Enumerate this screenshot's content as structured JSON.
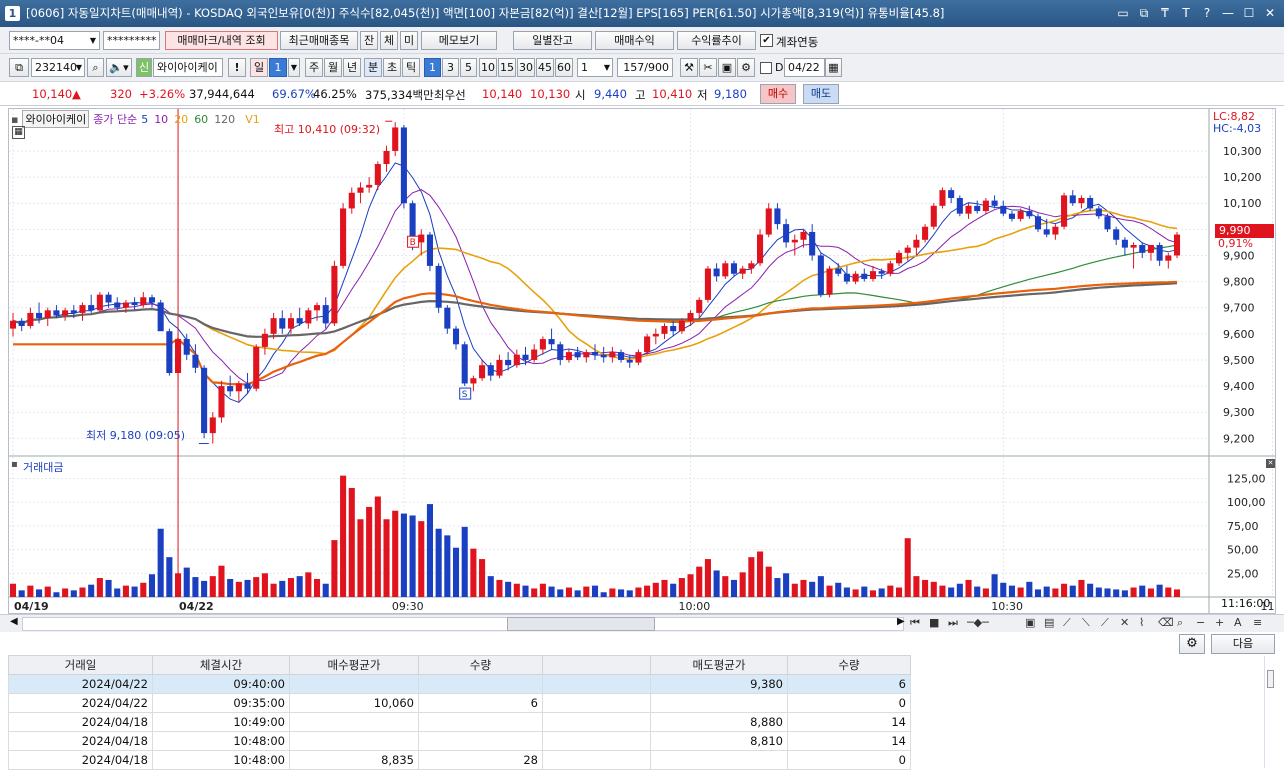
{
  "window": {
    "num": "1",
    "title": "[0606] 자동일지차트(매매내역) - KOSDAQ 외국인보유[0(천)] 주식수[82,045(천)] 액면[100] 자본금[82(억)] 결산[12월] EPS[165] PER[61.50] 시가총액[8,319(억)] 유통비율[45.8]",
    "icons": [
      "layout-icon",
      "restore-icon",
      "pin-icon",
      "font-icon",
      "help-icon",
      "minimize-icon",
      "maximize-icon",
      "close-icon"
    ],
    "icon_glyphs": [
      "▭",
      "⧉",
      "₸",
      "T",
      "?",
      "—",
      "☐",
      "✕"
    ]
  },
  "toolbar1": {
    "account": "****-**04",
    "password": "*********",
    "btn_mark": "매매마크/내역 조회",
    "btn_recent": "최근매매종목",
    "btn_jan": "잔",
    "btn_che": "체",
    "btn_mi": "미",
    "btn_memo": "메모보기",
    "btn_daily": "일별잔고",
    "btn_profit": "매매수익",
    "btn_rate": "수익률추이",
    "chk_link": "계좌연동"
  },
  "toolbar2": {
    "code": "232140",
    "credit_badge": "신",
    "name": "와이아이케이",
    "excl": "!",
    "p_day": "일",
    "p_day_n": "1",
    "p_week": "주",
    "p_month": "월",
    "p_year": "년",
    "p_min": "분",
    "p_sec": "초",
    "p_tick": "틱",
    "mins": [
      "1",
      "3",
      "5",
      "10",
      "15",
      "30",
      "45",
      "60"
    ],
    "count": "1",
    "range": "157",
    "range_total": "/900",
    "chk_d": "D",
    "date": "04/22"
  },
  "quote": {
    "price": "10,140",
    "arrow": "▲",
    "change": "320",
    "pct": "+3.26%",
    "volume": "37,944,644",
    "r1": "69.67%",
    "r2": "46.25%",
    "amount": "375,334백만",
    "bid_label": "최우선",
    "bid1": "10,140",
    "bid2": "10,130",
    "open_l": "시",
    "open": "9,440",
    "high_l": "고",
    "high": "10,410",
    "low_l": "저",
    "low": "9,180",
    "buy": "매수",
    "sell": "매도"
  },
  "chart": {
    "legend_name": "와이아이케이",
    "legend_ma": "종가 단순",
    "ma_periods": [
      "5",
      "10",
      "20",
      "60",
      "120"
    ],
    "ma_colors": [
      "#1a3fc0",
      "#8a1fb0",
      "#e8a10d",
      "#2e8b3a",
      "#666666"
    ],
    "legend_v1": "V1",
    "max_label": "최고 10,410 (09:32)",
    "min_label": "최저 9,180 (09:05)",
    "lc": "LC:8,82",
    "hc": "HC:-4,03",
    "cur_price": "9,990",
    "cur_pct": "0,91%",
    "buy_mark": "B",
    "sell_mark": "S",
    "vol_title": "거래대금",
    "dates": [
      "04/19",
      "04/22",
      "09:30",
      "10:00",
      "10:30",
      "11:00"
    ],
    "time_now": "11:16:00"
  },
  "chart_data": {
    "type": "candlestick",
    "price_axis": {
      "ticks": [
        "10,300",
        "10,200",
        "10,100",
        "10,000",
        "9,900",
        "9,800",
        "9,700",
        "9,600",
        "9,500",
        "9,400",
        "9,300",
        "9,200"
      ],
      "range": [
        9140,
        10430
      ]
    },
    "volume_axis": {
      "ticks": [
        "125,00",
        "100,00",
        "75,00",
        "50,00",
        "25,00"
      ],
      "range": [
        0,
        135
      ]
    },
    "candles": [
      [
        9620,
        9680,
        9590,
        9650
      ],
      [
        9650,
        9660,
        9610,
        9630
      ],
      [
        9630,
        9700,
        9620,
        9680
      ],
      [
        9680,
        9720,
        9640,
        9660
      ],
      [
        9660,
        9700,
        9630,
        9690
      ],
      [
        9690,
        9710,
        9660,
        9670
      ],
      [
        9670,
        9700,
        9650,
        9690
      ],
      [
        9690,
        9710,
        9660,
        9680
      ],
      [
        9680,
        9720,
        9650,
        9710
      ],
      [
        9710,
        9750,
        9680,
        9690
      ],
      [
        9690,
        9760,
        9680,
        9750
      ],
      [
        9750,
        9760,
        9700,
        9720
      ],
      [
        9720,
        9740,
        9690,
        9700
      ],
      [
        9700,
        9730,
        9680,
        9720
      ],
      [
        9720,
        9740,
        9690,
        9710
      ],
      [
        9710,
        9760,
        9700,
        9740
      ],
      [
        9740,
        9750,
        9700,
        9720
      ],
      [
        9720,
        9730,
        9660,
        9610
      ],
      [
        9610,
        9620,
        9440,
        9450
      ],
      [
        9450,
        9600,
        9420,
        9580
      ],
      [
        9580,
        9600,
        9500,
        9520
      ],
      [
        9520,
        9560,
        9450,
        9470
      ],
      [
        9470,
        9480,
        9200,
        9220
      ],
      [
        9220,
        9300,
        9180,
        9280
      ],
      [
        9280,
        9420,
        9260,
        9400
      ],
      [
        9400,
        9440,
        9360,
        9380
      ],
      [
        9380,
        9420,
        9340,
        9410
      ],
      [
        9410,
        9450,
        9370,
        9390
      ],
      [
        9390,
        9560,
        9380,
        9550
      ],
      [
        9550,
        9620,
        9520,
        9600
      ],
      [
        9600,
        9680,
        9580,
        9660
      ],
      [
        9660,
        9690,
        9600,
        9620
      ],
      [
        9620,
        9680,
        9600,
        9660
      ],
      [
        9660,
        9700,
        9630,
        9640
      ],
      [
        9640,
        9700,
        9620,
        9690
      ],
      [
        9690,
        9720,
        9650,
        9710
      ],
      [
        9710,
        9740,
        9620,
        9640
      ],
      [
        9640,
        9880,
        9630,
        9860
      ],
      [
        9860,
        10100,
        9850,
        10080
      ],
      [
        10080,
        10160,
        10060,
        10140
      ],
      [
        10140,
        10180,
        10100,
        10160
      ],
      [
        10160,
        10200,
        10140,
        10170
      ],
      [
        10170,
        10260,
        10150,
        10250
      ],
      [
        10250,
        10320,
        10220,
        10300
      ],
      [
        10300,
        10410,
        10280,
        10390
      ],
      [
        10390,
        10400,
        10080,
        10100
      ],
      [
        10100,
        10110,
        9920,
        9950
      ],
      [
        9950,
        10000,
        9900,
        9980
      ],
      [
        9980,
        9990,
        9840,
        9860
      ],
      [
        9860,
        9870,
        9680,
        9700
      ],
      [
        9700,
        9710,
        9600,
        9620
      ],
      [
        9620,
        9630,
        9540,
        9560
      ],
      [
        9560,
        9570,
        9400,
        9410
      ],
      [
        9410,
        9440,
        9380,
        9430
      ],
      [
        9430,
        9500,
        9420,
        9480
      ],
      [
        9480,
        9490,
        9420,
        9440
      ],
      [
        9440,
        9520,
        9430,
        9500
      ],
      [
        9500,
        9530,
        9460,
        9480
      ],
      [
        9480,
        9540,
        9470,
        9520
      ],
      [
        9520,
        9550,
        9480,
        9500
      ],
      [
        9500,
        9560,
        9490,
        9540
      ],
      [
        9540,
        9590,
        9520,
        9580
      ],
      [
        9580,
        9620,
        9540,
        9560
      ],
      [
        9560,
        9570,
        9480,
        9500
      ],
      [
        9500,
        9540,
        9490,
        9530
      ],
      [
        9530,
        9550,
        9500,
        9510
      ],
      [
        9510,
        9540,
        9490,
        9530
      ],
      [
        9530,
        9560,
        9500,
        9520
      ],
      [
        9520,
        9550,
        9490,
        9510
      ],
      [
        9510,
        9550,
        9490,
        9530
      ],
      [
        9530,
        9540,
        9490,
        9500
      ],
      [
        9500,
        9520,
        9470,
        9490
      ],
      [
        9490,
        9540,
        9480,
        9530
      ],
      [
        9530,
        9600,
        9520,
        9590
      ],
      [
        9590,
        9620,
        9560,
        9600
      ],
      [
        9600,
        9640,
        9580,
        9630
      ],
      [
        9630,
        9650,
        9590,
        9610
      ],
      [
        9610,
        9660,
        9600,
        9650
      ],
      [
        9650,
        9690,
        9630,
        9680
      ],
      [
        9680,
        9740,
        9660,
        9730
      ],
      [
        9730,
        9860,
        9720,
        9850
      ],
      [
        9850,
        9870,
        9800,
        9820
      ],
      [
        9820,
        9880,
        9810,
        9870
      ],
      [
        9870,
        9880,
        9820,
        9830
      ],
      [
        9830,
        9860,
        9810,
        9850
      ],
      [
        9850,
        9880,
        9830,
        9870
      ],
      [
        9870,
        10000,
        9860,
        9980
      ],
      [
        9980,
        10100,
        9970,
        10080
      ],
      [
        10080,
        10100,
        10000,
        10020
      ],
      [
        10020,
        10040,
        9930,
        9950
      ],
      [
        9950,
        9980,
        9900,
        9960
      ],
      [
        9960,
        10000,
        9930,
        9990
      ],
      [
        9990,
        10020,
        9880,
        9900
      ],
      [
        9900,
        9910,
        9740,
        9750
      ],
      [
        9750,
        9860,
        9740,
        9850
      ],
      [
        9850,
        9870,
        9820,
        9830
      ],
      [
        9830,
        9860,
        9790,
        9800
      ],
      [
        9800,
        9840,
        9790,
        9830
      ],
      [
        9830,
        9850,
        9800,
        9810
      ],
      [
        9810,
        9860,
        9800,
        9840
      ],
      [
        9840,
        9850,
        9810,
        9830
      ],
      [
        9830,
        9880,
        9820,
        9870
      ],
      [
        9870,
        9920,
        9860,
        9910
      ],
      [
        9910,
        9940,
        9880,
        9930
      ],
      [
        9930,
        9980,
        9900,
        9960
      ],
      [
        9960,
        10020,
        9950,
        10010
      ],
      [
        10010,
        10100,
        10000,
        10090
      ],
      [
        10090,
        10160,
        10080,
        10150
      ],
      [
        10150,
        10160,
        10100,
        10120
      ],
      [
        10120,
        10130,
        10050,
        10060
      ],
      [
        10060,
        10100,
        10040,
        10090
      ],
      [
        10090,
        10110,
        10060,
        10070
      ],
      [
        10070,
        10120,
        10060,
        10110
      ],
      [
        10110,
        10130,
        10080,
        10090
      ],
      [
        10090,
        10110,
        10050,
        10060
      ],
      [
        10060,
        10070,
        10030,
        10040
      ],
      [
        10040,
        10080,
        10030,
        10070
      ],
      [
        10070,
        10090,
        10040,
        10050
      ],
      [
        10050,
        10060,
        9990,
        10000
      ],
      [
        10000,
        10040,
        9970,
        9980
      ],
      [
        9980,
        10020,
        9960,
        10010
      ],
      [
        10010,
        10140,
        10000,
        10130
      ],
      [
        10130,
        10150,
        10090,
        10100
      ],
      [
        10100,
        10130,
        10080,
        10120
      ],
      [
        10120,
        10130,
        10070,
        10080
      ],
      [
        10080,
        10090,
        10040,
        10050
      ],
      [
        10050,
        10060,
        9990,
        10000
      ],
      [
        10000,
        10010,
        9940,
        9960
      ],
      [
        9960,
        9970,
        9900,
        9930
      ],
      [
        9930,
        9950,
        9850,
        9940
      ],
      [
        9940,
        9950,
        9890,
        9910
      ],
      [
        9910,
        9920,
        9880,
        9940
      ],
      [
        9940,
        9950,
        9860,
        9880
      ],
      [
        9880,
        9910,
        9850,
        9900
      ],
      [
        9900,
        9990,
        9890,
        9980
      ]
    ],
    "volume": [
      14,
      7,
      12,
      8,
      11,
      5,
      9,
      7,
      10,
      13,
      20,
      18,
      9,
      12,
      11,
      15,
      24,
      72,
      42,
      25,
      31,
      21,
      17,
      22,
      33,
      19,
      16,
      18,
      21,
      25,
      14,
      17,
      20,
      22,
      26,
      19,
      14,
      60,
      128,
      115,
      82,
      95,
      106,
      82,
      91,
      88,
      86,
      80,
      98,
      72,
      65,
      52,
      74,
      51,
      40,
      22,
      18,
      16,
      14,
      12,
      9,
      14,
      11,
      8,
      10,
      7,
      11,
      12,
      5,
      9,
      8,
      7,
      10,
      12,
      15,
      18,
      14,
      20,
      24,
      32,
      40,
      28,
      22,
      18,
      26,
      42,
      48,
      32,
      20,
      25,
      14,
      18,
      16,
      22,
      12,
      15,
      10,
      8,
      11,
      7,
      9,
      12,
      10,
      62,
      22,
      18,
      16,
      12,
      10,
      14,
      18,
      11,
      9,
      24,
      15,
      12,
      10,
      16,
      8,
      11,
      9,
      14,
      12,
      18,
      14,
      10,
      9,
      8,
      7,
      10,
      12,
      9,
      13,
      10,
      8,
      6,
      9,
      11,
      8,
      7,
      10
    ]
  },
  "hscroll": {
    "left_arrow": "◀",
    "right_arrow": "▶"
  },
  "nav": {
    "icons": [
      "first-icon",
      "stop-icon",
      "last-icon",
      "zoom-slider-icon",
      "layout-a-icon",
      "layout-b-icon",
      "draw-line-icon",
      "draw-trend-icon",
      "draw-fib-icon",
      "draw-x-icon",
      "draw-text-icon",
      "erase-icon",
      "magnifier-icon",
      "minus-icon",
      "plus-icon",
      "text-a-icon",
      "menu-icon"
    ],
    "glyphs": [
      "⏮",
      "■",
      "⏭",
      "─◆─",
      "▣",
      "▤",
      "⟋",
      "⟍",
      "⟋",
      "✕",
      "⌇",
      "⌫",
      "⌕",
      "−",
      "+",
      "A",
      "≡"
    ]
  },
  "grid": {
    "next_btn": "다음",
    "headers": [
      "거래일",
      "체결시간",
      "매수평균가",
      "수량",
      "",
      "매도평균가",
      "수량"
    ],
    "rows": [
      [
        "2024/04/22",
        "09:40:00",
        "",
        "",
        "",
        "9,380",
        "6"
      ],
      [
        "2024/04/22",
        "09:35:00",
        "10,060",
        "6",
        "",
        "",
        "0"
      ],
      [
        "2024/04/18",
        "10:49:00",
        "",
        "",
        "",
        "8,880",
        "14"
      ],
      [
        "2024/04/18",
        "10:48:00",
        "",
        "",
        "",
        "8,810",
        "14"
      ],
      [
        "2024/04/18",
        "10:48:00",
        "8,835",
        "28",
        "",
        "",
        "0"
      ]
    ]
  }
}
